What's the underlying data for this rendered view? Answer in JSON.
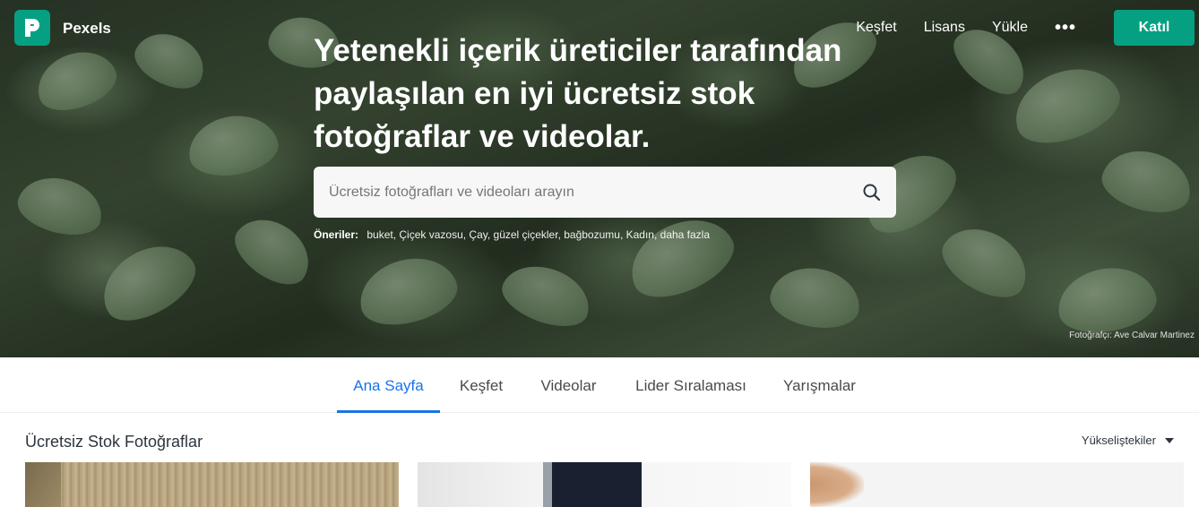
{
  "brand": {
    "name": "Pexels",
    "logo_icon": "pexels-logo-icon",
    "accent": "#05a081"
  },
  "nav": {
    "links": [
      "Keşfet",
      "Lisans",
      "Yükle"
    ],
    "more_label": "•••",
    "join_label": "Katıl"
  },
  "hero": {
    "headline": "Yetenekli içerik üreticiler tarafından paylaşılan en iyi ücretsiz stok fotoğraflar ve videolar.",
    "search_placeholder": "Ücretsiz fotoğrafları ve videoları arayın",
    "suggestions_label": "Öneriler:",
    "suggestions": "buket, Çiçek vazosu, Çay, güzel çiçekler, bağbozumu, Kadın, daha fazla",
    "photo_credit": "Fotoğrafçı: Ave Calvar Martinez"
  },
  "tabs": {
    "items": [
      "Ana Sayfa",
      "Keşfet",
      "Videolar",
      "Lider Sıralaması",
      "Yarışmalar"
    ],
    "active": "Ana Sayfa",
    "active_color": "#1a73e8"
  },
  "section": {
    "title": "Ücretsiz Stok Fotoğraflar",
    "sort_label": "Yükselişteki­ler"
  }
}
